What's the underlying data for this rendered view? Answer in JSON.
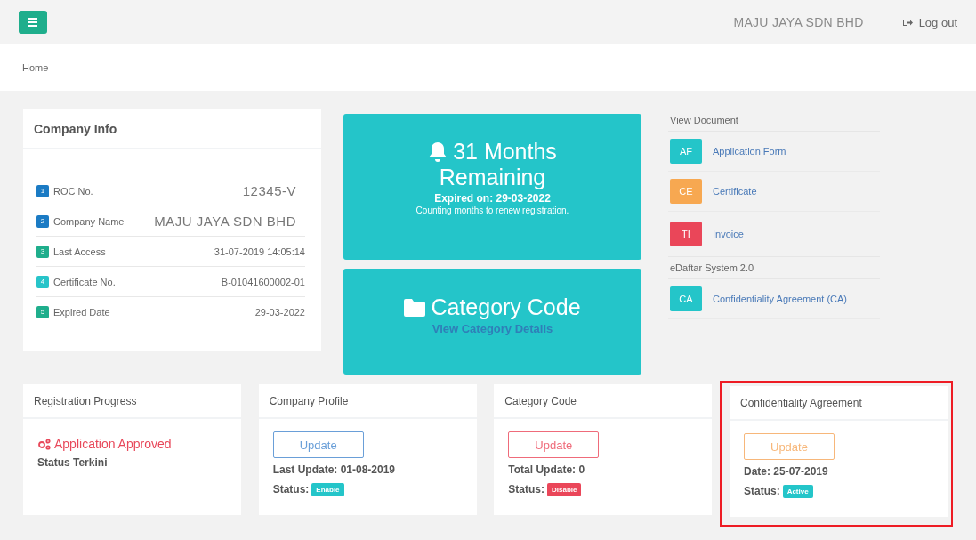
{
  "topbar": {
    "company": "MAJU JAYA SDN BHD",
    "logout": "Log out"
  },
  "breadcrumb": "Home",
  "company_info": {
    "title": "Company Info",
    "rows": [
      {
        "badge": "1",
        "color": "#1b7bc4",
        "label": "ROC No.",
        "value": "12345-V",
        "large": true
      },
      {
        "badge": "2",
        "color": "#1b7bc4",
        "label": "Company Name",
        "value": "MAJU JAYA SDN BHD",
        "large": true
      },
      {
        "badge": "3",
        "color": "#1fae8c",
        "label": "Last Access",
        "value": "31-07-2019 14:05:14",
        "large": false
      },
      {
        "badge": "4",
        "color": "#27c4c9",
        "label": "Certificate No.",
        "value": "B-01041600002-01",
        "large": false
      },
      {
        "badge": "5",
        "color": "#1fae8c",
        "label": "Expired Date",
        "value": "29-03-2022",
        "large": false
      }
    ]
  },
  "remaining": {
    "line1": "31 Months",
    "line2": "Remaining",
    "expired": "Expired on: 29-03-2022",
    "note": "Counting months to renew registration."
  },
  "category_tile": {
    "title": "Category Code",
    "link": "View Category Details"
  },
  "documents": [
    {
      "heading": "View Document",
      "items": [
        {
          "code": "AF",
          "color": "#24c5c9",
          "label": "Application Form"
        },
        {
          "code": "CE",
          "color": "#f7a851",
          "label": "Certificate"
        },
        {
          "code": "TI",
          "color": "#ea4659",
          "label": "Invoice"
        }
      ]
    },
    {
      "heading": "eDaftar System 2.0",
      "items": [
        {
          "code": "CA",
          "color": "#24c5c9",
          "label": "Confidentiality Agreement (CA)"
        }
      ]
    }
  ],
  "cards": [
    {
      "kind": "progress",
      "title": "Registration Progress",
      "status": "Application Approved",
      "note": "Status Terkini",
      "highlighted": false
    },
    {
      "kind": "update",
      "title": "Company Profile",
      "button": {
        "label": "Update",
        "color": "#6a9fd8"
      },
      "info": "Last Update: 01-08-2019",
      "status_label": "Status:",
      "badge": {
        "label": "Enable",
        "color": "#24c5c9"
      },
      "highlighted": false
    },
    {
      "kind": "update",
      "title": "Category Code",
      "button": {
        "label": "Update",
        "color": "#ef6b7a"
      },
      "info": "Total Update: 0",
      "status_label": "Status:",
      "badge": {
        "label": "Disable",
        "color": "#ea4659"
      },
      "highlighted": false
    },
    {
      "kind": "update",
      "title": "Confidentiality Agreement",
      "button": {
        "label": "Update",
        "color": "#f7b77a"
      },
      "info": "Date: 25-07-2019",
      "status_label": "Status:",
      "badge": {
        "label": "Active",
        "color": "#24c5c9"
      },
      "highlighted": true
    }
  ]
}
